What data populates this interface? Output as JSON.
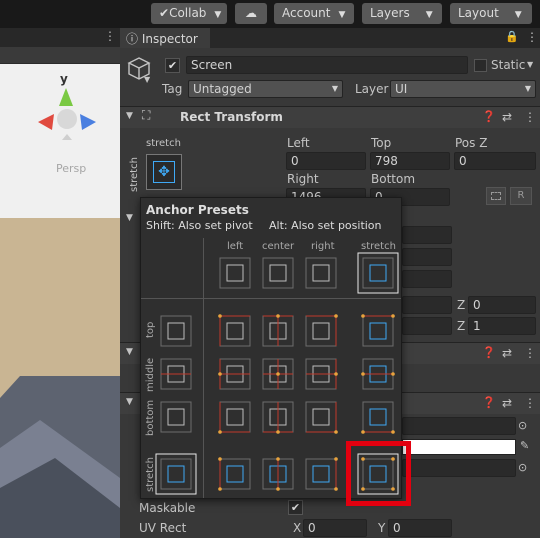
{
  "toolbar": {
    "collab": "Collab",
    "account": "Account",
    "layers": "Layers",
    "layout": "Layout"
  },
  "scene": {
    "axis_label": "y",
    "persp": "Persp"
  },
  "inspector": {
    "tab": "Inspector",
    "object_name": "Screen",
    "static_label": "Static",
    "tag_label": "Tag",
    "tag_value": "Untagged",
    "layer_label": "Layer",
    "layer_value": "UI"
  },
  "rect_transform": {
    "title": "Rect Transform",
    "stretch": "stretch",
    "stretch_vert": "stretch",
    "left_label": "Left",
    "top_label": "Top",
    "posz_label": "Pos Z",
    "left": "0",
    "top": "798",
    "posz": "0",
    "right_label": "Right",
    "bottom_label": "Bottom",
    "right": "1496",
    "bottom": "0",
    "r_btn": "R"
  },
  "anchor_presets": {
    "title": "Anchor Presets",
    "hint1": "Shift: Also set pivot",
    "hint2": "Alt: Also set position",
    "cols": [
      "left",
      "center",
      "right",
      "stretch"
    ],
    "rows": [
      "top",
      "middle",
      "bottom",
      "stretch"
    ]
  },
  "behind": {
    "z1_label": "Z",
    "z1": "0",
    "z2_label": "Z",
    "z2": "1"
  },
  "image": {
    "maskable": "Maskable",
    "uv_rect": "UV Rect",
    "x_label": "X",
    "x": "0",
    "y_label": "Y",
    "y": "0"
  }
}
